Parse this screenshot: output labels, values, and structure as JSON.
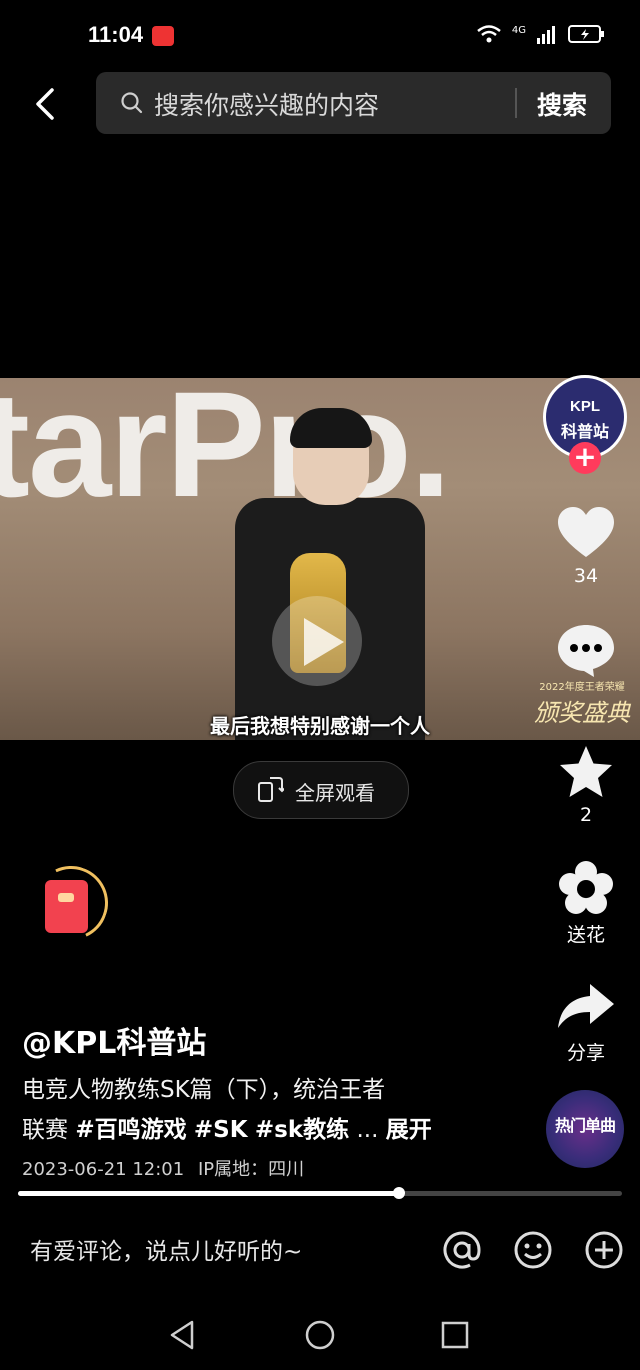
{
  "status": {
    "time": "11:04",
    "network": "4G"
  },
  "search": {
    "placeholder": "搜索你感兴趣的内容",
    "button": "搜索"
  },
  "video": {
    "subtitle": "最后我想特别感谢一个人",
    "banner_text": "tarPro.",
    "event_logo_top": "2022年度王者荣耀",
    "event_logo_main": "颁奖盛典",
    "fullscreen_label": "全屏观看"
  },
  "channel": {
    "avatar_line1": "KPL",
    "avatar_line2": "科普站",
    "follow": "+"
  },
  "actions": {
    "like_count": "34",
    "favorite_count": "2",
    "gift_label": "送花",
    "share_label": "分享"
  },
  "post": {
    "author": "@KPL科普站",
    "desc_line1": "电竞人物教练SK篇（下），统治王者",
    "desc_line2_prefix": "联赛",
    "tags": [
      "#百鸣游戏",
      "#SK",
      "#sk教练"
    ],
    "ellipsis": "...",
    "expand": "展开",
    "date": "2023-06-21 12:01",
    "ip": "IP属地：四川"
  },
  "music": {
    "label": "热门单曲"
  },
  "progress": {
    "fraction": 0.63
  },
  "comment": {
    "placeholder": "有爱评论，说点儿好听的~"
  },
  "colors": {
    "follow": "#ff3b5c",
    "packet": "#f2424f"
  }
}
